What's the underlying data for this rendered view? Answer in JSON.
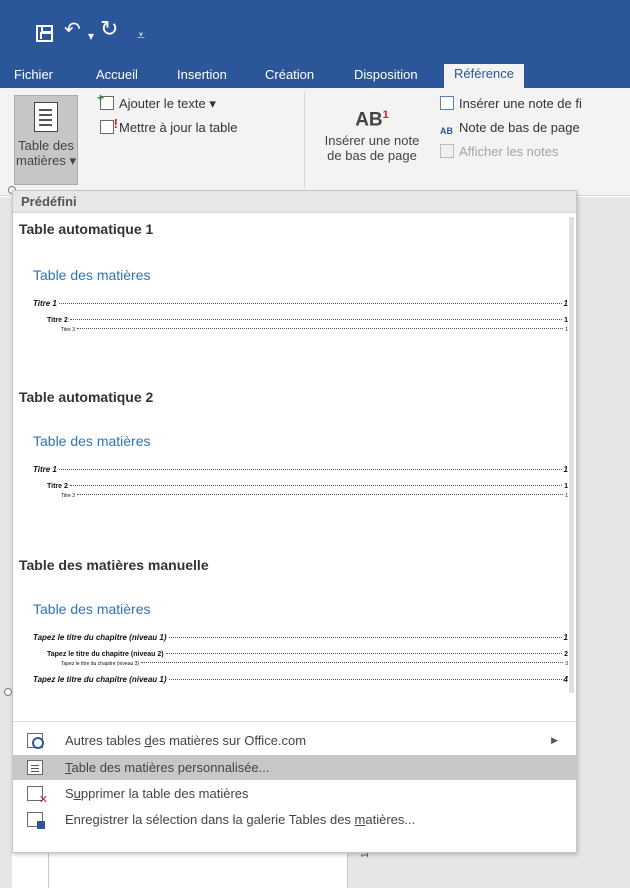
{
  "tabs": [
    {
      "label": "Fichier"
    },
    {
      "label": "Accueil"
    },
    {
      "label": "Insertion"
    },
    {
      "label": "Création"
    },
    {
      "label": "Disposition"
    },
    {
      "label": "Référence"
    }
  ],
  "ribbon": {
    "toc_button_line1": "Table des",
    "toc_button_line2": "matières ▾",
    "add_text": "Ajouter le texte ▾",
    "update_table": "Mettre à jour la table",
    "footnote_big_label": "AB",
    "footnote_big_sup": "1",
    "footnote_line1": "Insérer une note",
    "footnote_line2": "de bas de page",
    "insert_endnote": "Insérer une note de fi",
    "next_footnote": "Note de bas de page",
    "next_footnote_icon": "AB",
    "show_notes": "Afficher les notes"
  },
  "dropdown": {
    "section_header": "Prédéfini",
    "items": [
      {
        "title": "Table automatique 1",
        "heading": "Table des matières",
        "lines": [
          {
            "text": "Titre 1",
            "page": "1"
          },
          {
            "text": "Titre 2",
            "page": "1"
          },
          {
            "text": "Titre 3",
            "page": "1"
          }
        ]
      },
      {
        "title": "Table automatique 2",
        "heading": "Table des matières",
        "lines": [
          {
            "text": "Titre 1",
            "page": "1"
          },
          {
            "text": "Titre 2",
            "page": "1"
          },
          {
            "text": "Titre 3",
            "page": "1"
          }
        ]
      },
      {
        "title": "Table des matières manuelle",
        "heading": "Table des matières",
        "lines": [
          {
            "text": "Tapez le titre du chapitre (niveau 1)",
            "page": "1"
          },
          {
            "text": "Tapez le titre du chapitre (niveau 2)",
            "page": "2"
          },
          {
            "text": "Tapez le titre du chapitre (niveau 3)",
            "page": "3"
          },
          {
            "text": "Tapez le titre du chapitre (niveau 1)",
            "page": "4"
          }
        ]
      }
    ],
    "menu": {
      "more_office_pre": "Autres tables ",
      "more_office_u": "d",
      "more_office_post": "es matières sur Office.com",
      "custom_u": "T",
      "custom_post": "able des matières personnalisée...",
      "remove_pre": "S",
      "remove_u": "u",
      "remove_post": "pprimer la table des matières",
      "save_pre": "Enregistrer la sélection dans la galerie Tables des ",
      "save_u": "m",
      "save_post": "atières..."
    }
  },
  "footer": {
    "ruler_text": "17 · 1"
  },
  "icons": {
    "save": "save-icon",
    "undo": "undo-icon",
    "redo": "redo-icon",
    "customize": "customize-qat-icon",
    "submenu": "chevron-right-icon"
  },
  "colors": {
    "title_bar": "#2b579a",
    "ribbon": "#f3f3f3",
    "heading_blue": "#2e74b5",
    "hover": "#c8c8c8"
  }
}
